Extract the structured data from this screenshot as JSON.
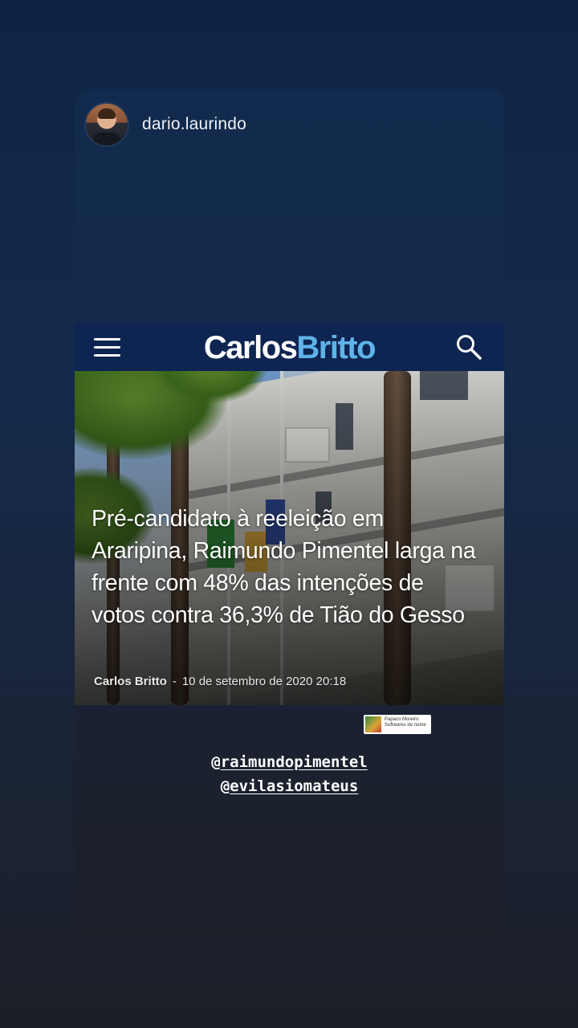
{
  "story": {
    "username": "dario.laurindo"
  },
  "site": {
    "logo_part1": "Carlos",
    "logo_part2": "Britto",
    "menu_icon": "hamburger-menu-icon",
    "search_icon": "search-icon",
    "colors": {
      "bar": "#0e2451",
      "logo_accent": "#5fb3e8"
    }
  },
  "article": {
    "headline": "Pré-candidato à reeleição em Araripina, Raimundo Pimentel larga na frente com 48% das intenções de votos contra 36,3% de Tião do Gesso",
    "author": "Carlos Britto",
    "separator": "-",
    "date": "10 de setembro de 2020 20:18"
  },
  "sticker": {
    "line1": "Papaco Moreiro",
    "line2": "Softwares de nome"
  },
  "mentions": [
    {
      "at": "@",
      "handle": "raimundopimentel"
    },
    {
      "at": "@",
      "handle": "evilasiomateus"
    }
  ]
}
